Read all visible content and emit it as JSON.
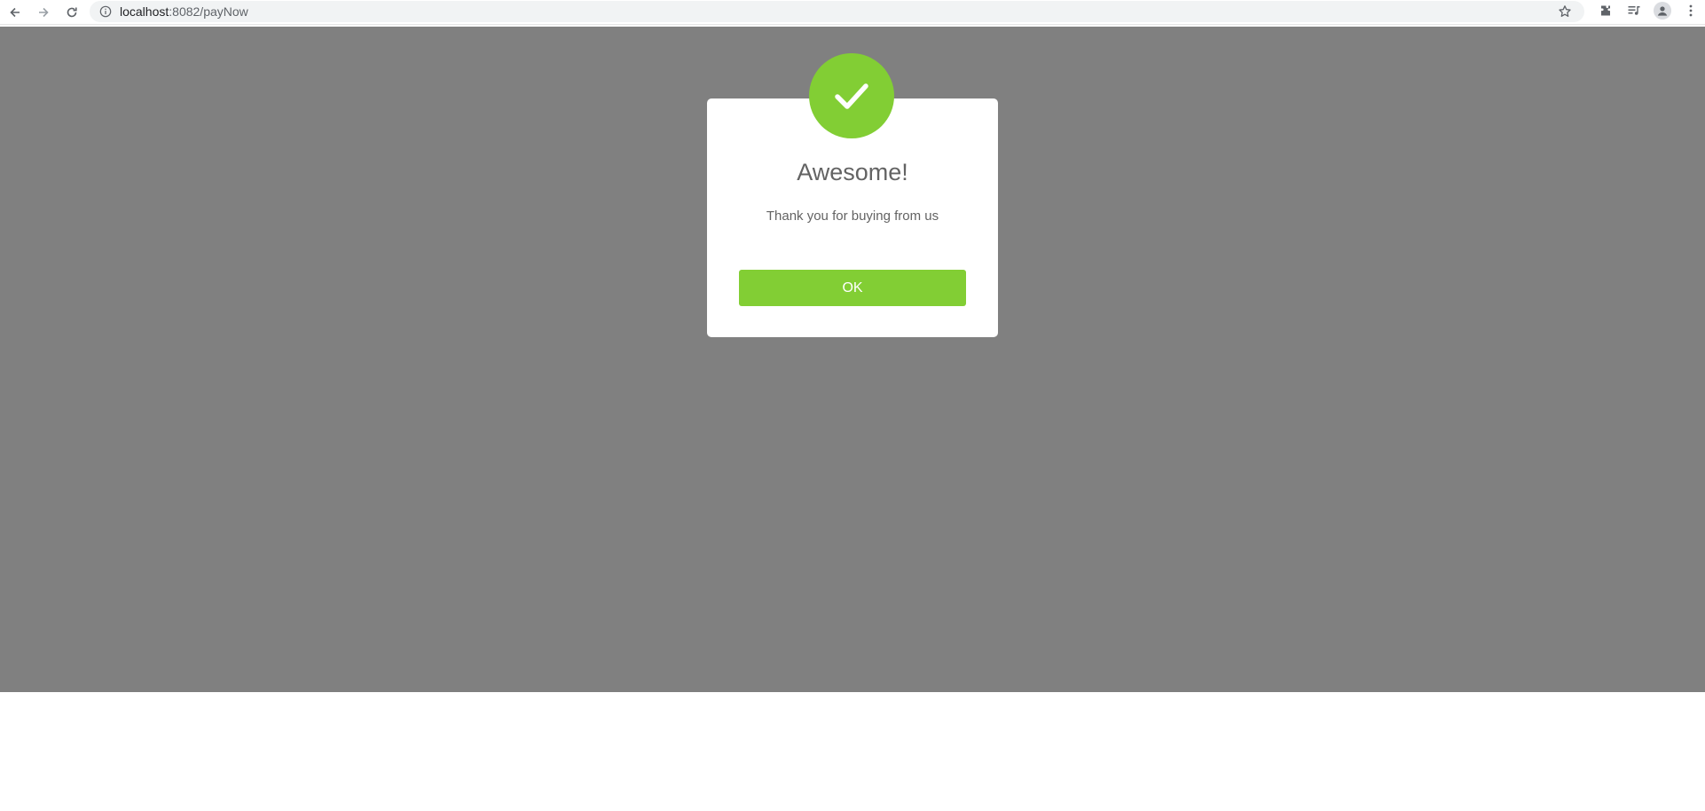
{
  "browser": {
    "url_host": "localhost",
    "url_path": ":8082/payNow",
    "icons": {
      "back": "back-arrow-icon",
      "forward": "forward-arrow-icon",
      "reload": "reload-icon",
      "site_info": "info-icon",
      "bookmark": "star-icon",
      "extensions": "puzzle-icon",
      "media": "media-queue-icon",
      "profile": "avatar-icon",
      "menu": "kebab-menu-icon"
    }
  },
  "dialog": {
    "icon": "checkmark-icon",
    "title": "Awesome!",
    "message": "Thank you for buying from us",
    "ok_label": "OK"
  },
  "colors": {
    "accent": "#82ce34",
    "overlay": "#808080",
    "text": "#636363"
  }
}
